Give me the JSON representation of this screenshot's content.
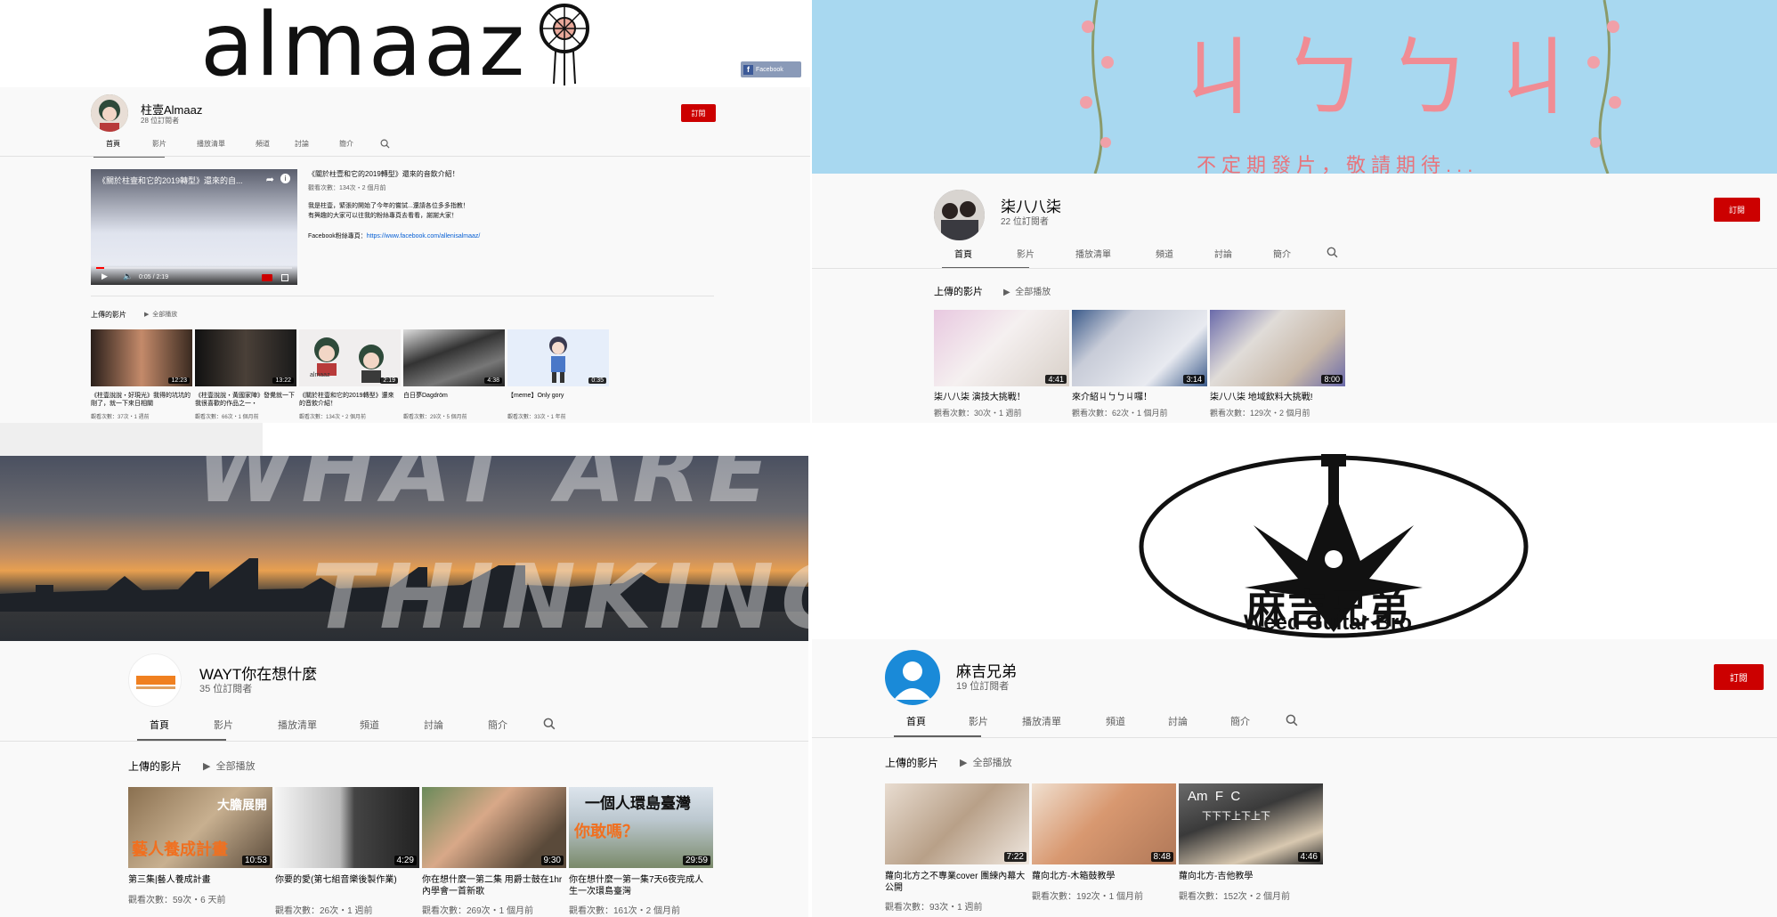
{
  "channels": [
    {
      "banner": {
        "logo_text": "almaaz"
      },
      "facebook_badge": "Facebook",
      "name": "柱壹Almaaz",
      "subs": "28 位訂閱者",
      "subscribe": "訂閱",
      "tabs": [
        "首頁",
        "影片",
        "播放清單",
        "頻道",
        "討論",
        "簡介"
      ],
      "featured": {
        "video_title": "《關於柱壹和它的2019轉型》還來的自...",
        "time": "0:05 / 2:19",
        "desc_title": "《關於柱壹和它的2019轉型》還來的音飲介紹！",
        "desc_meta": "觀看次數：134次・2 個月前",
        "desc_lines": [
          "我是柱壹，緊張的開始了今年的嘗試...還請各位多多指教！",
          "有興趣的大家可以往我的粉絲專頁去看看，謝謝大家！"
        ],
        "fb_label": "Facebook粉絲專頁：",
        "fb_link": "https://www.facebook.com/allenisalmaaz/"
      },
      "section": "上傳的影片",
      "play_all": "全部播放",
      "videos": [
        {
          "title": "《柱壹說說・好現光》我得的坑坑的剛了，就一下來日相關",
          "meta": "觀看次數：37次・1 週前",
          "dur": "12:23"
        },
        {
          "title": "《柱壹說說・黃國家陣》發覺就一下我很喜歡的作品之一・",
          "meta": "觀看次數：66次・1 個月前",
          "dur": "13:22"
        },
        {
          "title": "《關於柱壹和它的2019轉型》還來的音飲介紹！",
          "meta": "觀看次數：134次・2 個月前",
          "dur": "2:19",
          "thumb_text": "almaaz"
        },
        {
          "title": "白日夢Dagdröm",
          "meta": "觀看次數：29次・5 個月前",
          "dur": "4:38"
        },
        {
          "title": "【meme】Only gory",
          "meta": "觀看次數：33次・1 年前",
          "dur": "0:35"
        }
      ]
    },
    {
      "banner": {
        "title": "ㄐㄅㄅㄐ",
        "subtitle": "不定期發片，敬請期待..."
      },
      "name": "柒八八柒",
      "subs": "22 位訂閱者",
      "subscribe": "訂閱",
      "tabs": [
        "首頁",
        "影片",
        "播放清單",
        "頻道",
        "討論",
        "簡介"
      ],
      "section": "上傳的影片",
      "play_all": "全部播放",
      "videos": [
        {
          "title": "柒八八柒 演技大挑戰！",
          "meta": "觀看次數：30次・1 週前",
          "dur": "4:41"
        },
        {
          "title": "來介紹ㄐㄅㄅㄐ囉！",
          "meta": "觀看次數：62次・1 個月前",
          "dur": "3:14"
        },
        {
          "title": "柒八八柒 地域飲料大挑戰!",
          "meta": "觀看次數：129次・2 個月前",
          "dur": "8:00"
        }
      ]
    },
    {
      "banner": {
        "line1": "WHAT ARE YO",
        "line2": "THINKING"
      },
      "name": "WAYT你在想什麼",
      "subs": "35 位訂閱者",
      "tabs": [
        "首頁",
        "影片",
        "播放清單",
        "頻道",
        "討論",
        "簡介"
      ],
      "section": "上傳的影片",
      "play_all": "全部播放",
      "videos": [
        {
          "title": "第三集|藝人養成計畫",
          "meta": "觀看次數：59次・6 天前",
          "dur": "10:53",
          "overlay": "大膽展開",
          "overlay2": "藝人養成計畫"
        },
        {
          "title": "你要的愛(第七組音樂後製作業)",
          "meta": "觀看次數：26次・1 週前",
          "dur": "4:29"
        },
        {
          "title": "你在想什麼一第二集 用爵士鼓在1hr內學會一首新歌",
          "meta": "觀看次數：269次・1 個月前",
          "dur": "9:30"
        },
        {
          "title": "你在想什麼一第一集7天6夜完成人生一次環島臺灣",
          "meta": "觀看次數：161次・2 個月前",
          "dur": "29:59",
          "overlay": "一個人環島臺灣",
          "overlay2": "你敢嗎？"
        }
      ]
    },
    {
      "banner": {
        "title": "麻吉兄弟",
        "subtitle": "Weed Guitar Bro"
      },
      "name": "麻吉兄弟",
      "subs": "19 位訂閱者",
      "subscribe": "訂閱",
      "tabs": [
        "首頁",
        "影片",
        "播放清單",
        "頻道",
        "討論",
        "簡介"
      ],
      "section": "上傳的影片",
      "play_all": "全部播放",
      "videos": [
        {
          "title": "蘿向北方之不專業cover 團練內幕大公開",
          "meta": "觀看次數：93次・1 週前",
          "dur": "7:22"
        },
        {
          "title": "蘿向北方-木箱鼓教學",
          "meta": "觀看次數：192次・1 個月前",
          "dur": "8:48"
        },
        {
          "title": "蘿向北方-吉他教學",
          "meta": "觀看次數：152次・2 個月前",
          "dur": "4:46",
          "chords": "Am  F  C",
          "strum": "下下下上下上下"
        }
      ]
    }
  ]
}
